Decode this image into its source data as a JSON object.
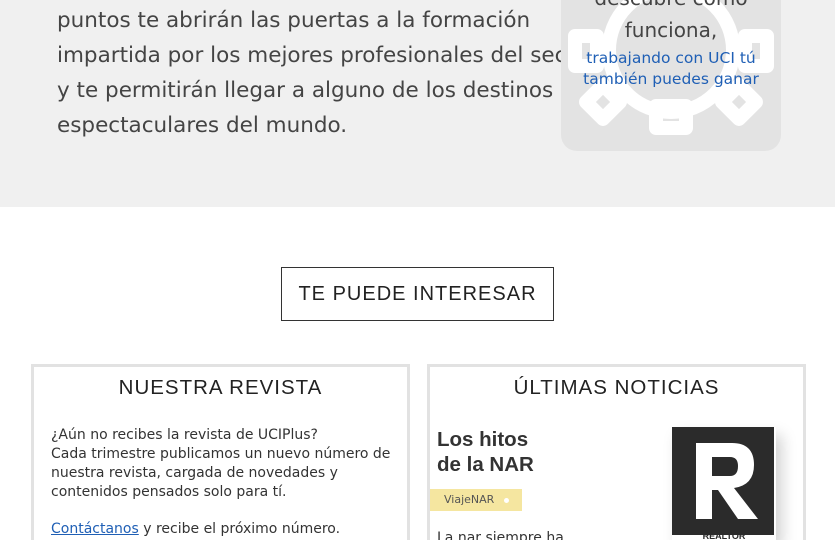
{
  "intro": {
    "lines": [
      "puntos te abrirán las puertas a la formación",
      "impartida por los mejores profesionales del sector,",
      "y te permitirán llegar a alguno de los destinos más",
      "espectaculares del mundo."
    ]
  },
  "promo": {
    "line1": "descubre cómo",
    "line2": "funciona,",
    "blue_line1": "trabajando con UCI tú",
    "blue_line2": "también puedes ganar",
    "accent_color": "#1f5fb5"
  },
  "section_button": {
    "label": "TE PUEDE INTERESAR"
  },
  "revista": {
    "title": "NUESTRA REVISTA",
    "lines": [
      "¿Aún no recibes la revista de UCIPlus?",
      "Cada trimestre publicamos un nuevo número de",
      "nuestra revista, cargada de novedades y",
      "contenidos pensados solo para tí."
    ],
    "contact_link": "Contáctanos",
    "contact_rest": " y recibe el próximo número."
  },
  "noticias": {
    "title": "ÚLTIMAS NOTICIAS",
    "headline_line1": "Los hitos",
    "headline_line2": "de la NAR",
    "tag": "ViajeNAR",
    "excerpt": "La nar siempre ha",
    "logo_text": "REALTOR"
  }
}
